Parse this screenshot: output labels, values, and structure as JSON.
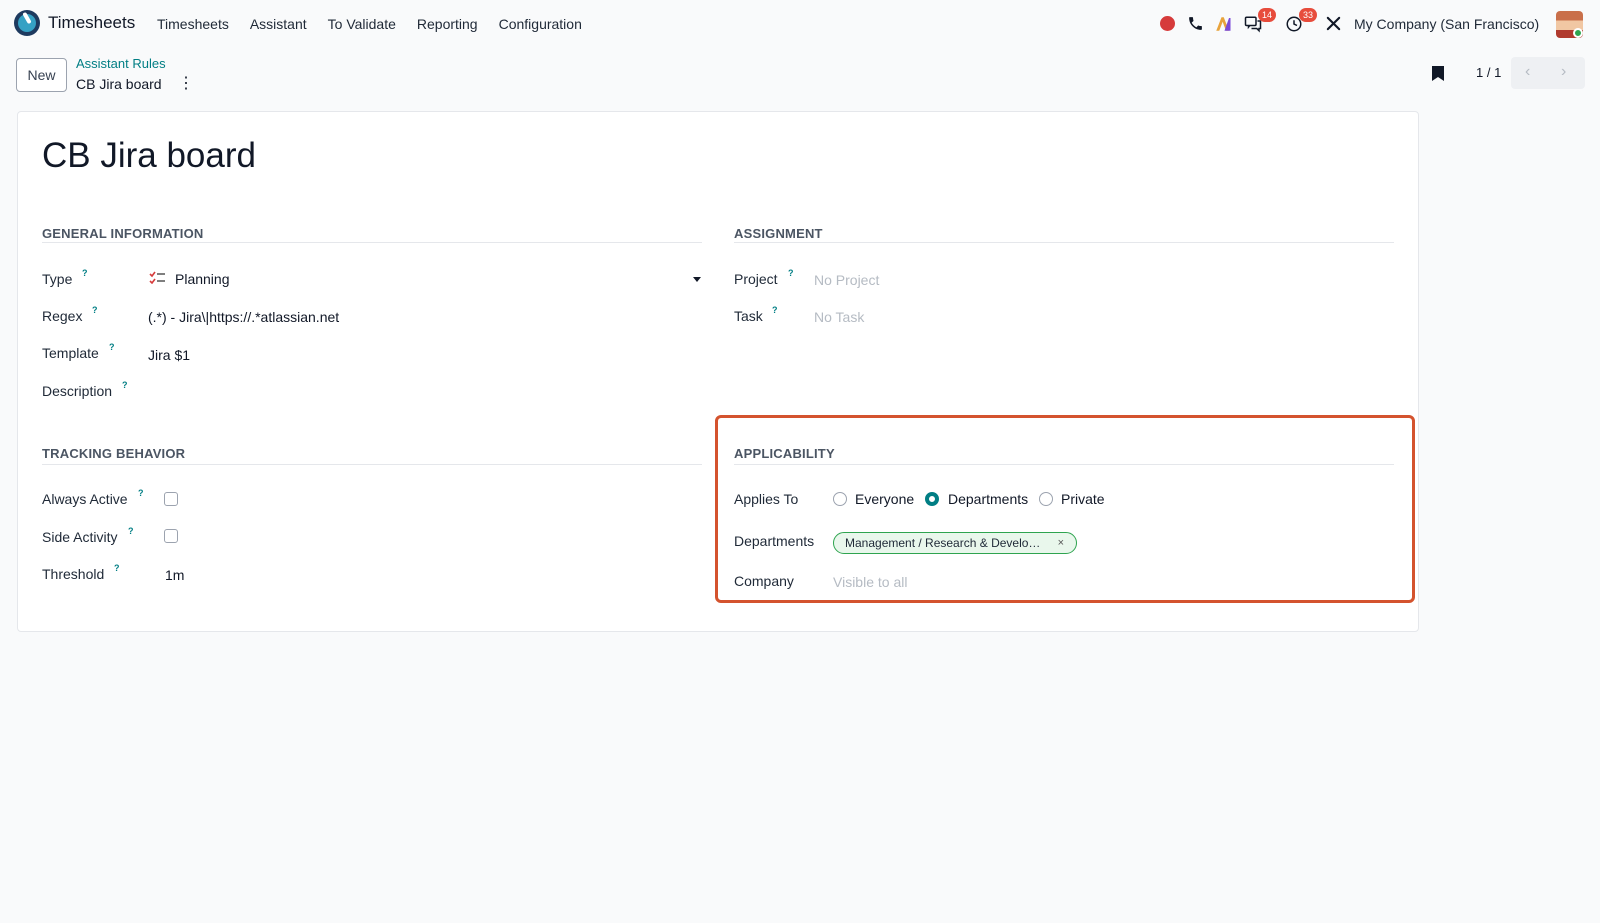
{
  "nav": {
    "app_name": "Timesheets",
    "menu": [
      "Timesheets",
      "Assistant",
      "To Validate",
      "Reporting",
      "Configuration"
    ],
    "messages_badge": "14",
    "activities_badge": "33",
    "company": "My Company (San Francisco)"
  },
  "control": {
    "new_label": "New",
    "breadcrumb_parent": "Assistant Rules",
    "breadcrumb_current": "CB Jira board",
    "pager_value": "1 / 1"
  },
  "form": {
    "title": "CB Jira board",
    "general_info": {
      "heading": "GENERAL INFORMATION",
      "type_label": "Type",
      "type_value": "Planning",
      "regex_label": "Regex",
      "regex_value": "(.*) - Jira\\|https://.*atlassian.net",
      "template_label": "Template",
      "template_value": "Jira $1",
      "description_label": "Description"
    },
    "assignment": {
      "heading": "ASSIGNMENT",
      "project_label": "Project",
      "project_placeholder": "No Project",
      "task_label": "Task",
      "task_placeholder": "No Task"
    },
    "tracking": {
      "heading": "TRACKING BEHAVIOR",
      "always_active_label": "Always Active",
      "always_active_checked": false,
      "side_activity_label": "Side Activity",
      "side_activity_checked": false,
      "threshold_label": "Threshold",
      "threshold_value": "1m"
    },
    "applicability": {
      "heading": "APPLICABILITY",
      "applies_to_label": "Applies To",
      "options": [
        "Everyone",
        "Departments",
        "Private"
      ],
      "selected": "Departments",
      "departments_label": "Departments",
      "department_tag": "Management / Research & Develo…",
      "company_label": "Company",
      "company_placeholder": "Visible to all"
    },
    "help_marker": "?"
  },
  "colors": {
    "accent": "#017e84",
    "highlight_border": "#d4532e",
    "badge": "#e74c3c",
    "tag_border": "#2ea44f"
  }
}
